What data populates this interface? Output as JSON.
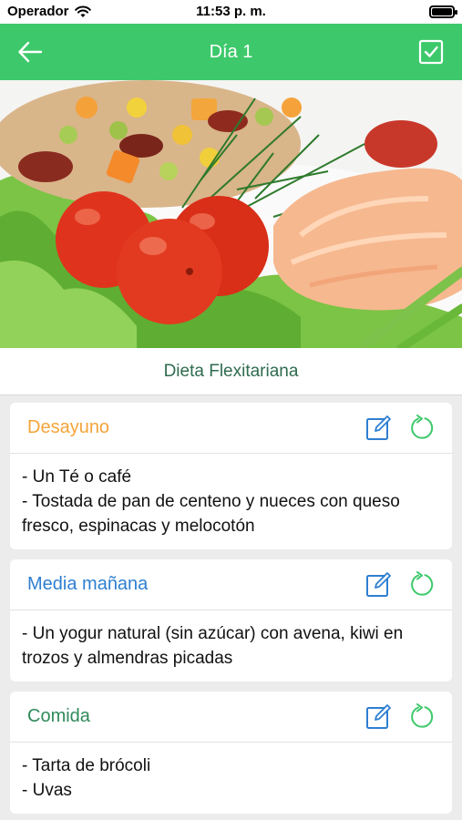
{
  "status": {
    "carrier": "Operador",
    "time": "11:53 p. m."
  },
  "nav": {
    "title": "Día 1"
  },
  "diet": {
    "name": "Dieta Flexitariana"
  },
  "meals": [
    {
      "title": "Desayuno",
      "color": "#f5a43a",
      "lines": [
        "- Un Té o café",
        "- Tostada de pan de centeno y nueces con queso fresco, espinacas y melocotón"
      ]
    },
    {
      "title": "Media mañana",
      "color": "#2e7fd1",
      "lines": [
        "- Un yogur natural (sin azúcar) con avena, kiwi en trozos y almendras picadas"
      ]
    },
    {
      "title": "Comida",
      "color": "#2f8a5b",
      "lines": [
        "- Tarta de brócoli",
        "- Uvas"
      ]
    }
  ],
  "colors": {
    "accent": "#3dc96b",
    "edit_icon": "#2e7fd1",
    "refresh_icon": "#3dc96b"
  },
  "icons": {
    "back": "arrow-left-icon",
    "done": "checkbox-icon",
    "edit": "edit-icon",
    "refresh": "refresh-icon",
    "wifi": "wifi-icon",
    "battery": "battery-icon"
  },
  "battery_level": 0.9
}
